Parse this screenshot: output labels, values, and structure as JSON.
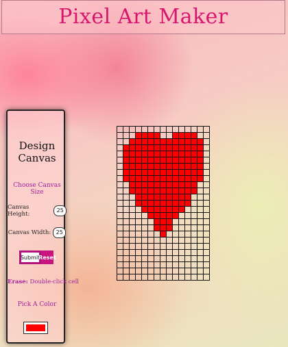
{
  "header": {
    "title": "Pixel Art Maker"
  },
  "panel": {
    "title": "Design Canvas",
    "choose_size": "Choose Canvas Size",
    "height_label": "Canvas Height:",
    "height_value": "25",
    "width_label": "Canvas Width:",
    "width_value": "25",
    "submit_label": "Submit",
    "reset_label": "Reset",
    "erase_label": "Erase:",
    "erase_hint": "Double-click cell",
    "pick_color": "Pick A Color",
    "selected_color": "#ff0000"
  },
  "canvas": {
    "rows": 25,
    "cols": 15,
    "fill_color": "#ff0000",
    "filled": [
      [
        1,
        [
          3,
          6
        ],
        [
          9,
          12
        ]
      ],
      [
        2,
        [
          2,
          7
        ],
        [
          8,
          13
        ]
      ],
      [
        3,
        [
          1,
          13
        ]
      ],
      [
        4,
        [
          1,
          13
        ]
      ],
      [
        5,
        [
          1,
          13
        ]
      ],
      [
        6,
        [
          1,
          13
        ]
      ],
      [
        7,
        [
          1,
          13
        ]
      ],
      [
        8,
        [
          1,
          13
        ]
      ],
      [
        9,
        [
          2,
          12
        ]
      ],
      [
        10,
        [
          2,
          12
        ]
      ],
      [
        11,
        [
          3,
          11
        ]
      ],
      [
        12,
        [
          3,
          11
        ]
      ],
      [
        13,
        [
          4,
          10
        ]
      ],
      [
        14,
        [
          5,
          9
        ]
      ],
      [
        15,
        [
          6,
          8
        ]
      ],
      [
        16,
        [
          6,
          8
        ]
      ],
      [
        17,
        [
          7,
          7
        ]
      ]
    ]
  }
}
